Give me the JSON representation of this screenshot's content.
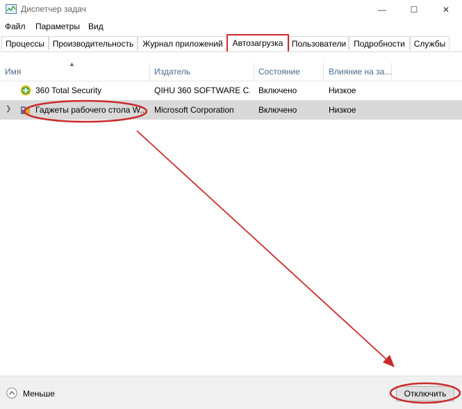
{
  "window": {
    "title": "Диспетчер задач",
    "controls": {
      "minimize": "—",
      "maximize": "☐",
      "close": "✕"
    }
  },
  "menu": {
    "items": [
      "Файл",
      "Параметры",
      "Вид"
    ]
  },
  "tabs": {
    "items": [
      "Процессы",
      "Производительность",
      "Журнал приложений",
      "Автозагрузка",
      "Пользователи",
      "Подробности",
      "Службы"
    ],
    "active": "Автозагрузка"
  },
  "table": {
    "columns": [
      "Имя",
      "Издатель",
      "Состояние",
      "Влияние на за..."
    ],
    "rows": [
      {
        "name": "360 Total Security",
        "publisher": "QIHU 360 SOFTWARE C...",
        "status": "Включено",
        "impact": "Низкое",
        "icon": "360-shield-icon"
      },
      {
        "name": "Гаджеты рабочего стола W...",
        "publisher": "Microsoft Corporation",
        "status": "Включено",
        "impact": "Низкое",
        "icon": "gadgets-icon"
      }
    ]
  },
  "footer": {
    "less_label": "Меньше",
    "disable_button": "Отключить"
  },
  "colors": {
    "annotation_red": "#cc2a2a",
    "selected_row": "#d9d9d9",
    "header_text": "#4a6a8a"
  }
}
